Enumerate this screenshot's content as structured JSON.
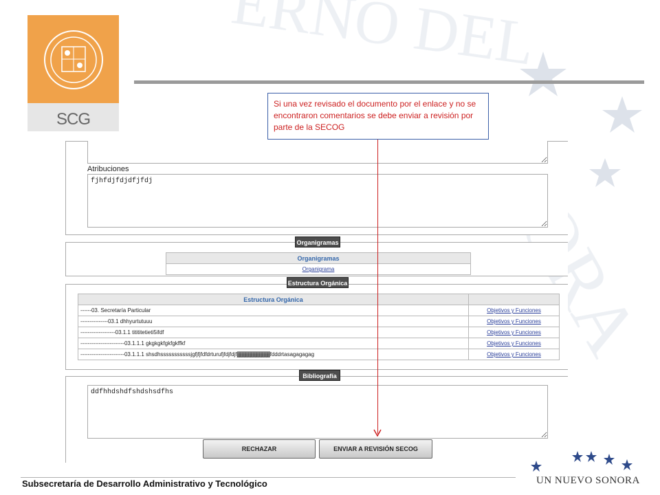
{
  "logo": {
    "text": "SCG"
  },
  "callout": {
    "text": "Si una vez revisado el documento por el enlace y no se encontraron comentarios se debe enviar a revisión por parte de la SECOG"
  },
  "form": {
    "atribuciones_label": "Atribuciones",
    "atribuciones_value": "fjhfdjfdjdfjfdj",
    "organigramas_section": "Organigramas",
    "organigramas_table": {
      "header": "Organigramas",
      "link": "Organigrama"
    },
    "estructura_section": "Estructura Orgánica",
    "estructura_table": {
      "header": "Estructura Orgánica",
      "rows": [
        {
          "name": "------03. Secretaría Particular",
          "link": "Objetivos y Funciones"
        },
        {
          "name": "---------------03.1 dhhyurtutuuu",
          "link": "Objetivos y Funciones"
        },
        {
          "name": "-------------------03.1.1 titititetieti5ifdf",
          "link": "Objetivos y Funciones"
        },
        {
          "name": "------------------------03.1.1.1 gkgkgkfgkfgkffkf",
          "link": "Objetivos y Funciones"
        },
        {
          "name_start": "------------------------03.1.1.1 shsdhsssssssssssjgfjfjfdfdrturufjfdjfdjf",
          "name_highlight": "jjjjjjjjjjjjjjjjjjjjjjjjjjj",
          "name_end": "fdddrtasagagagag",
          "link": "Objetivos y Funciones"
        }
      ]
    },
    "bibliografia_section": "Bibliografía",
    "bibliografia_value": "ddfhhdshdfshdshsdfhs",
    "reject_button": "RECHAZAR",
    "send_button": "ENVIAR A REVISIÓN SECOG"
  },
  "footer": {
    "text": "Subsecretaría de Desarrollo Administrativo y Tecnológico",
    "brand": "UN NUEVO SONORA"
  },
  "colors": {
    "logo_orange": "#f0a24a",
    "callout_text": "#cc2020",
    "callout_border": "#3b5fa8",
    "link": "#2a3f9a"
  }
}
